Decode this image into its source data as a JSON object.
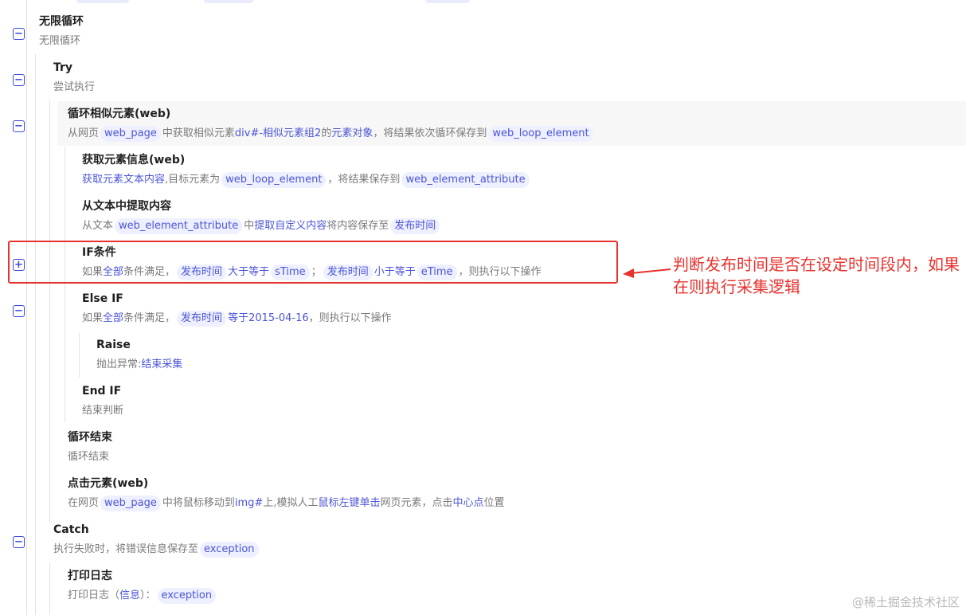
{
  "loop": {
    "title": "无限循环",
    "desc": "无限循环"
  },
  "try": {
    "title": "Try",
    "desc": "尝试执行"
  },
  "loop_similar": {
    "title": "循环相似元素(web)",
    "t1": "从网页",
    "chip1": "web_page",
    "t2": "中获取相似元素",
    "kw1": "div#-相似元素组2",
    "t3": "的",
    "kw2": "元素对象",
    "t4": "，将结果依次循环保存到",
    "chip2": "web_loop_element"
  },
  "get_info": {
    "title": "获取元素信息(web)",
    "kw1": "获取元素文本内容",
    "t1": ",目标元素为",
    "chip1": "web_loop_element",
    "t2": "，将结果保存到",
    "chip2": "web_element_attribute"
  },
  "extract": {
    "title": "从文本中提取内容",
    "t1": "从文本",
    "chip1": "web_element_attribute",
    "t2": "中",
    "kw1": "提取自定义内容",
    "t3": "将内容保存至",
    "chip2": "发布时间"
  },
  "if": {
    "title": "IF条件",
    "t1": "如果",
    "kw1": "全部",
    "t2": "条件满足，",
    "chip1": "发布时间",
    "kw2": "大于等于",
    "chip2": "sTime",
    "t3": "；",
    "chip3": "发布时间",
    "kw3": "小于等于",
    "chip4": "eTime",
    "t4": "，则执行以下操作"
  },
  "elseif": {
    "title": "Else IF",
    "t1": "如果",
    "kw1": "全部",
    "t2": "条件满足，",
    "chip1": "发布时间",
    "kw2": "等于",
    "kw3": "2015-04-16",
    "t3": "，则执行以下操作"
  },
  "raise": {
    "title": "Raise",
    "t1": "抛出异常:",
    "kw1": "结束采集"
  },
  "endif": {
    "title": "End IF",
    "desc": "结束判断"
  },
  "loop_end": {
    "title": "循环结束",
    "desc": "循环结束"
  },
  "click": {
    "title": "点击元素(web)",
    "t1": "在网页",
    "chip1": "web_page",
    "t2": "中将鼠标移动到",
    "kw1": "img#",
    "t3": "上,模拟人工",
    "kw2": "鼠标左键单击",
    "t4": "网页元素，点击",
    "kw3": "中心点",
    "t5": "位置"
  },
  "catch": {
    "title": "Catch",
    "t1": "执行失败时，将错误信息保存至",
    "chip1": "exception"
  },
  "log": {
    "title": "打印日志",
    "t1": "打印日志（",
    "kw1": "信息",
    "t2": "）：",
    "chip1": "exception"
  },
  "annotation": {
    "text": "判断发布时间是否在设定时间段内，如果在则执行采集逻辑",
    "color": "#e8322e"
  },
  "watermark": "@稀土掘金技术社区",
  "toggles": {
    "minus": "−",
    "plus": "+"
  },
  "colors": {
    "accent": "#4b55d6",
    "chip_bg": "#eef0ff",
    "annotation": "#e8322e"
  }
}
